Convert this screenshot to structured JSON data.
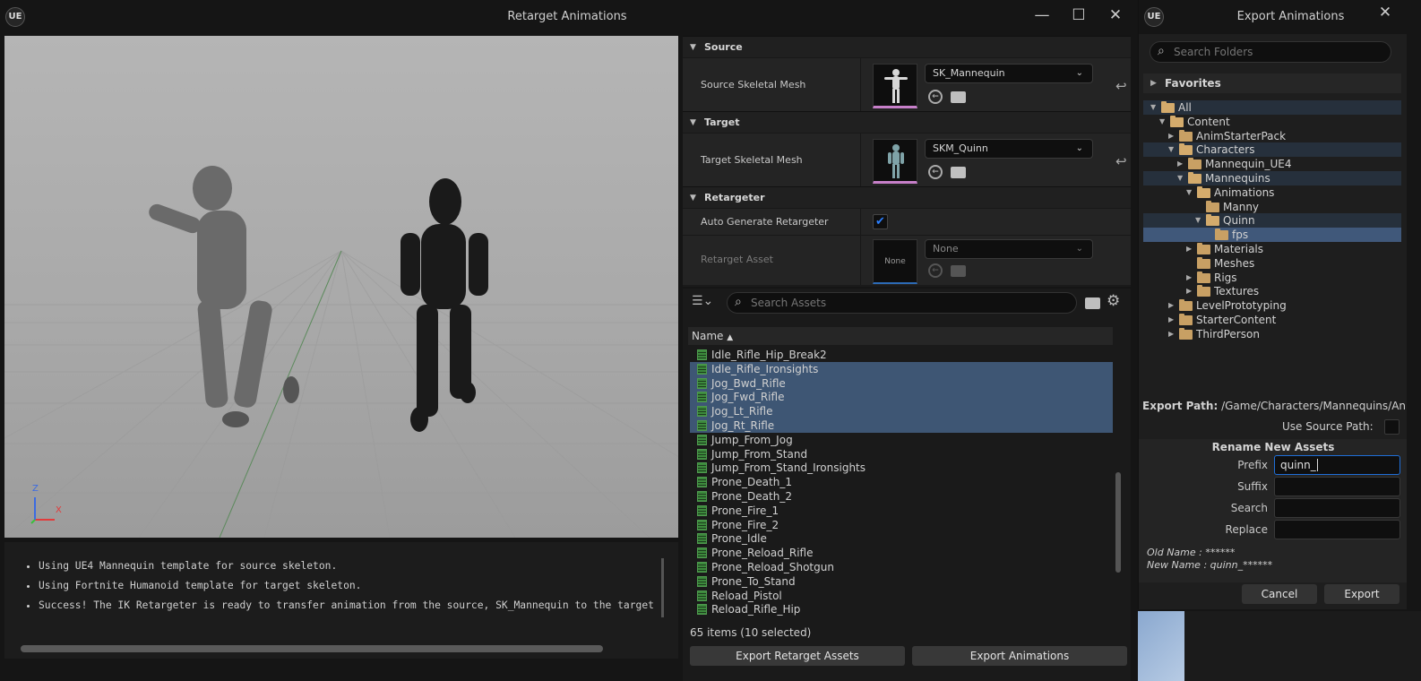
{
  "retarget": {
    "title": "Retarget Animations",
    "logo": "UE",
    "window_buttons": {
      "minimize": "—",
      "maximize": "☐",
      "close": "✕"
    },
    "sections": {
      "source": {
        "label": "Source",
        "prop_label": "Source Skeletal Mesh",
        "value": "SK_Mannequin"
      },
      "target": {
        "label": "Target",
        "prop_label": "Target Skeletal Mesh",
        "value": "SKM_Quinn"
      },
      "retargeter": {
        "label": "Retargeter",
        "auto_label": "Auto Generate Retargeter",
        "auto_checked": true,
        "asset_label": "Retarget Asset",
        "asset_value": "None",
        "thumb_text": "None"
      }
    },
    "search": {
      "placeholder": "Search Assets"
    },
    "list_header": "Name",
    "assets": [
      {
        "name": "Idle_Rifle_Hip_Break2",
        "selected": false
      },
      {
        "name": "Idle_Rifle_Ironsights",
        "selected": true
      },
      {
        "name": "Jog_Bwd_Rifle",
        "selected": true
      },
      {
        "name": "Jog_Fwd_Rifle",
        "selected": true
      },
      {
        "name": "Jog_Lt_Rifle",
        "selected": true
      },
      {
        "name": "Jog_Rt_Rifle",
        "selected": true
      },
      {
        "name": "Jump_From_Jog",
        "selected": false
      },
      {
        "name": "Jump_From_Stand",
        "selected": false
      },
      {
        "name": "Jump_From_Stand_Ironsights",
        "selected": false
      },
      {
        "name": "Prone_Death_1",
        "selected": false
      },
      {
        "name": "Prone_Death_2",
        "selected": false
      },
      {
        "name": "Prone_Fire_1",
        "selected": false
      },
      {
        "name": "Prone_Fire_2",
        "selected": false
      },
      {
        "name": "Prone_Idle",
        "selected": false
      },
      {
        "name": "Prone_Reload_Rifle",
        "selected": false
      },
      {
        "name": "Prone_Reload_Shotgun",
        "selected": false
      },
      {
        "name": "Prone_To_Stand",
        "selected": false
      },
      {
        "name": "Reload_Pistol",
        "selected": false
      },
      {
        "name": "Reload_Rifle_Hip",
        "selected": false
      }
    ],
    "item_count": "65 items (10 selected)",
    "buttons": {
      "export_retarget": "Export Retarget Assets",
      "export_anims": "Export Animations"
    },
    "log": [
      "Using UE4 Mannequin template for source skeleton.",
      "Using Fortnite Humanoid template for target skeleton.",
      "Success! The IK Retargeter is ready to transfer animation from the source, SK_Mannequin to the target"
    ],
    "axis": {
      "z": "Z",
      "x": "X"
    }
  },
  "export": {
    "title": "Export Animations",
    "logo": "UE",
    "close": "✕",
    "search": {
      "placeholder": "Search Folders"
    },
    "favorites": "Favorites",
    "tree": [
      {
        "label": "All",
        "depth": 0,
        "state": "open",
        "style": "hl"
      },
      {
        "label": "Content",
        "depth": 1,
        "state": "open",
        "style": ""
      },
      {
        "label": "AnimStarterPack",
        "depth": 2,
        "state": "closed",
        "style": ""
      },
      {
        "label": "Characters",
        "depth": 2,
        "state": "open",
        "style": "hl"
      },
      {
        "label": "Mannequin_UE4",
        "depth": 3,
        "state": "closed",
        "style": ""
      },
      {
        "label": "Mannequins",
        "depth": 3,
        "state": "open",
        "style": "hl"
      },
      {
        "label": "Animations",
        "depth": 4,
        "state": "open",
        "style": ""
      },
      {
        "label": "Manny",
        "depth": 5,
        "state": "none",
        "style": ""
      },
      {
        "label": "Quinn",
        "depth": 5,
        "state": "open",
        "style": "hl"
      },
      {
        "label": "fps",
        "depth": 6,
        "state": "none",
        "style": "sel"
      },
      {
        "label": "Materials",
        "depth": 4,
        "state": "closed",
        "style": ""
      },
      {
        "label": "Meshes",
        "depth": 4,
        "state": "none",
        "style": ""
      },
      {
        "label": "Rigs",
        "depth": 4,
        "state": "closed",
        "style": ""
      },
      {
        "label": "Textures",
        "depth": 4,
        "state": "closed",
        "style": ""
      },
      {
        "label": "LevelPrototyping",
        "depth": 2,
        "state": "closed",
        "style": ""
      },
      {
        "label": "StarterContent",
        "depth": 2,
        "state": "closed",
        "style": ""
      },
      {
        "label": "ThirdPerson",
        "depth": 2,
        "state": "closed",
        "style": ""
      }
    ],
    "export_path_label": "Export Path:",
    "export_path_value": "/Game/Characters/Mannequins/Anim",
    "use_source_path": "Use Source Path:",
    "rename_header": "Rename New Assets",
    "fields": {
      "prefix": {
        "label": "Prefix",
        "value": "quinn_"
      },
      "suffix": {
        "label": "Suffix",
        "value": ""
      },
      "search": {
        "label": "Search",
        "value": ""
      },
      "replace": {
        "label": "Replace",
        "value": ""
      }
    },
    "old_name": "Old Name : ******",
    "new_name": "New Name : quinn_******",
    "cancel": "Cancel",
    "export": "Export"
  },
  "colors": {
    "accent": "#1f6fd8",
    "selection": "#3e5674",
    "thumb_border": "#c77fc9"
  }
}
